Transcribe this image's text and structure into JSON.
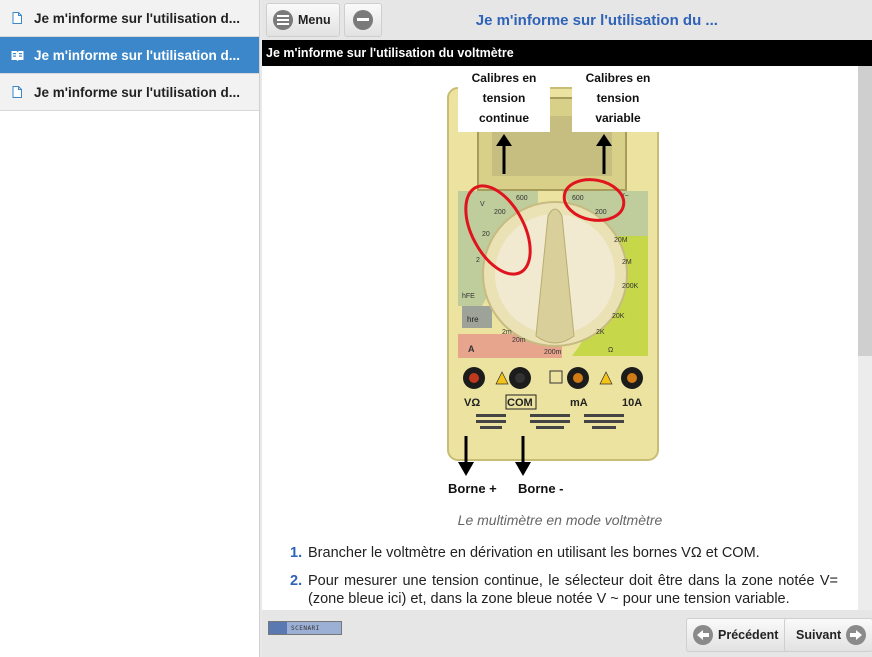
{
  "sidebar": {
    "items": [
      {
        "label": "Je m'informe sur l'utilisation d...",
        "active": false
      },
      {
        "label": "Je m'informe sur l'utilisation d...",
        "active": true
      },
      {
        "label": "Je m'informe sur l'utilisation d...",
        "active": false
      }
    ]
  },
  "toolbar": {
    "menu_label": "Menu",
    "title": "Je m'informe sur l'utilisation du ..."
  },
  "content": {
    "header": "Je m'informe sur l'utilisation du voltmètre",
    "figure": {
      "label_left": [
        "Calibres en",
        "tension",
        "continue"
      ],
      "label_right": [
        "Calibres en",
        "tension",
        "variable"
      ],
      "borne_plus": "Borne +",
      "borne_minus": "Borne -",
      "terminal_vo": "VΩ",
      "terminal_com": "COM",
      "terminal_ma": "mA",
      "terminal_10a": "10A",
      "zone_vdc": "V",
      "zone_vac": "V~",
      "zone_a": "A",
      "zone_hfe": "hFE",
      "scale_vdc": [
        "600",
        "200",
        "20",
        "2"
      ],
      "scale_vac": [
        "600",
        "200"
      ],
      "scale_ohm": [
        "20M",
        "2M",
        "200K",
        "20K",
        "2K",
        "Ω"
      ],
      "scale_a": [
        "20m",
        "200m",
        "2m"
      ]
    },
    "caption": "Le multimètre en mode voltmètre",
    "steps": [
      {
        "num": "1.",
        "text": "Brancher le voltmètre en dérivation en utilisant les bornes VΩ et COM."
      },
      {
        "num": "2.",
        "text": "Pour mesurer une tension continue, le sélecteur doit être dans la zone notée V= (zone bleue ici) et, dans la zone bleue notée V ~ pour une tension variable."
      }
    ]
  },
  "footer": {
    "logo_text": "SCENARI",
    "prev_label": "Précédent",
    "next_label": "Suivant"
  },
  "colors": {
    "accent": "#3b87c9",
    "title_blue": "#2e63b8",
    "highlight_red": "#e0141e",
    "multimeter_yellow": "#ece3a0"
  }
}
